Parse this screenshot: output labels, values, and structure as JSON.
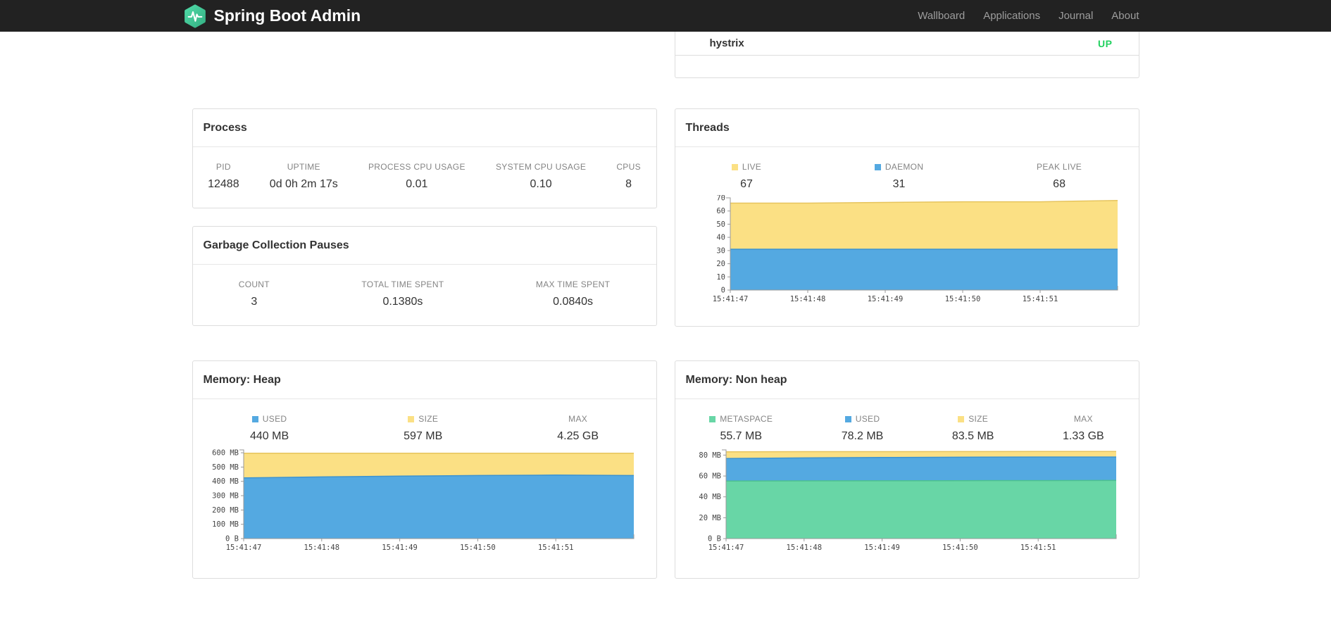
{
  "navbar": {
    "brand": "Spring Boot Admin",
    "items": [
      {
        "label": "Wallboard"
      },
      {
        "label": "Applications"
      },
      {
        "label": "Journal"
      },
      {
        "label": "About"
      }
    ]
  },
  "colors": {
    "navbar_bg": "#222222",
    "brand_green": "#42C794",
    "status_up": "#23d160",
    "series_yellow": "#FBE084",
    "series_blue": "#54A9E1",
    "series_green": "#68D6A6"
  },
  "health": {
    "rows": [
      {
        "name": "hystrix",
        "status": "UP"
      }
    ]
  },
  "process": {
    "title": "Process",
    "metrics": [
      {
        "label": "PID",
        "value": "12488"
      },
      {
        "label": "UPTIME",
        "value": "0d 0h 2m 17s"
      },
      {
        "label": "PROCESS CPU USAGE",
        "value": "0.01"
      },
      {
        "label": "SYSTEM CPU USAGE",
        "value": "0.10"
      },
      {
        "label": "CPUS",
        "value": "8"
      }
    ]
  },
  "gc": {
    "title": "Garbage Collection Pauses",
    "metrics": [
      {
        "label": "COUNT",
        "value": "3"
      },
      {
        "label": "TOTAL TIME SPENT",
        "value": "0.1380s"
      },
      {
        "label": "MAX TIME SPENT",
        "value": "0.0840s"
      }
    ]
  },
  "threads": {
    "title": "Threads",
    "legend": [
      {
        "label": "LIVE",
        "value": "67",
        "color": "#FBE084"
      },
      {
        "label": "DAEMON",
        "value": "31",
        "color": "#54A9E1"
      },
      {
        "label": "PEAK LIVE",
        "value": "68"
      }
    ]
  },
  "memory_heap": {
    "title": "Memory: Heap",
    "legend": [
      {
        "label": "USED",
        "value": "440 MB",
        "color": "#54A9E1"
      },
      {
        "label": "SIZE",
        "value": "597 MB",
        "color": "#FBE084"
      },
      {
        "label": "MAX",
        "value": "4.25 GB"
      }
    ]
  },
  "memory_nonheap": {
    "title": "Memory: Non heap",
    "legend": [
      {
        "label": "METASPACE",
        "value": "55.7 MB",
        "color": "#68D6A6"
      },
      {
        "label": "USED",
        "value": "78.2 MB",
        "color": "#54A9E1"
      },
      {
        "label": "SIZE",
        "value": "83.5 MB",
        "color": "#FBE084"
      },
      {
        "label": "MAX",
        "value": "1.33 GB"
      }
    ]
  },
  "chart_data": [
    {
      "id": "threads",
      "type": "area",
      "title": "Threads",
      "x_labels": [
        "15:41:47",
        "15:41:48",
        "15:41:49",
        "15:41:50",
        "15:41:51"
      ],
      "y_max": 70,
      "grid": false,
      "y_ticks": [
        {
          "v": 0,
          "label": "0"
        },
        {
          "v": 10,
          "label": "10"
        },
        {
          "v": 20,
          "label": "20"
        },
        {
          "v": 30,
          "label": "30"
        },
        {
          "v": 40,
          "label": "40"
        },
        {
          "v": 50,
          "label": "50"
        },
        {
          "v": 60,
          "label": "60"
        },
        {
          "v": 70,
          "label": "70"
        }
      ],
      "series": [
        {
          "name": "LIVE",
          "fill": "#FBE084",
          "stroke": "#E6C45E",
          "values": [
            66,
            66,
            66.5,
            67,
            67,
            68
          ]
        },
        {
          "name": "DAEMON",
          "fill": "#54A9E1",
          "stroke": "#3D93D0",
          "values": [
            31,
            31,
            31,
            31,
            31,
            31
          ]
        }
      ]
    },
    {
      "id": "heap",
      "type": "area",
      "title": "Memory: Heap (MB)",
      "x_labels": [
        "15:41:47",
        "15:41:48",
        "15:41:49",
        "15:41:50",
        "15:41:51"
      ],
      "y_max": 620,
      "grid": false,
      "y_ticks": [
        {
          "v": 0,
          "label": "0 B"
        },
        {
          "v": 100,
          "label": "100 MB"
        },
        {
          "v": 200,
          "label": "200 MB"
        },
        {
          "v": 300,
          "label": "300 MB"
        },
        {
          "v": 400,
          "label": "400 MB"
        },
        {
          "v": 500,
          "label": "500 MB"
        },
        {
          "v": 600,
          "label": "600 MB"
        }
      ],
      "series": [
        {
          "name": "SIZE",
          "fill": "#FBE084",
          "stroke": "#E6C45E",
          "values": [
            597,
            597,
            597,
            597,
            597,
            597
          ]
        },
        {
          "name": "USED",
          "fill": "#54A9E1",
          "stroke": "#3D93D0",
          "values": [
            424,
            431,
            437,
            441,
            444,
            441
          ]
        }
      ]
    },
    {
      "id": "nonheap",
      "type": "area",
      "title": "Memory: Non heap (MB)",
      "x_labels": [
        "15:41:47",
        "15:41:48",
        "15:41:49",
        "15:41:50",
        "15:41:51"
      ],
      "y_max": 85,
      "grid": false,
      "y_ticks": [
        {
          "v": 0,
          "label": "0 B"
        },
        {
          "v": 20,
          "label": "20 MB"
        },
        {
          "v": 40,
          "label": "40 MB"
        },
        {
          "v": 60,
          "label": "60 MB"
        },
        {
          "v": 80,
          "label": "80 MB"
        }
      ],
      "series": [
        {
          "name": "SIZE",
          "fill": "#FBE084",
          "stroke": "#E6C45E",
          "values": [
            83.2,
            83.3,
            83.3,
            83.4,
            83.5,
            83.5
          ]
        },
        {
          "name": "USED",
          "fill": "#54A9E1",
          "stroke": "#3D93D0",
          "values": [
            76.8,
            77.3,
            77.7,
            78,
            78.2,
            78.2
          ]
        },
        {
          "name": "METASPACE",
          "fill": "#68D6A6",
          "stroke": "#4CC08F",
          "values": [
            55.1,
            55.3,
            55.4,
            55.5,
            55.6,
            55.7
          ]
        }
      ]
    }
  ]
}
